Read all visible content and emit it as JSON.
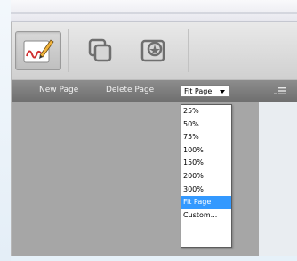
{
  "toolbar": {
    "buttons": [
      {
        "icon": "signature-pen-icon",
        "state": "active"
      },
      {
        "icon": "pages-icon",
        "state": "normal"
      },
      {
        "icon": "stamp-icon",
        "state": "normal"
      }
    ]
  },
  "menubar": {
    "new_page": "New Page",
    "delete_page": "Delete Page",
    "zoom_selected": "Fit Page",
    "options_icon": "menu-icon"
  },
  "zoom_options": [
    "25%",
    "50%",
    "75%",
    "100%",
    "150%",
    "200%",
    "300%",
    "Fit Page",
    "Custom..."
  ],
  "zoom_selected_index": 7,
  "colors": {
    "menubar": "#7f7f7f",
    "selection": "#3399ff",
    "canvas": "#a6a6a6"
  }
}
